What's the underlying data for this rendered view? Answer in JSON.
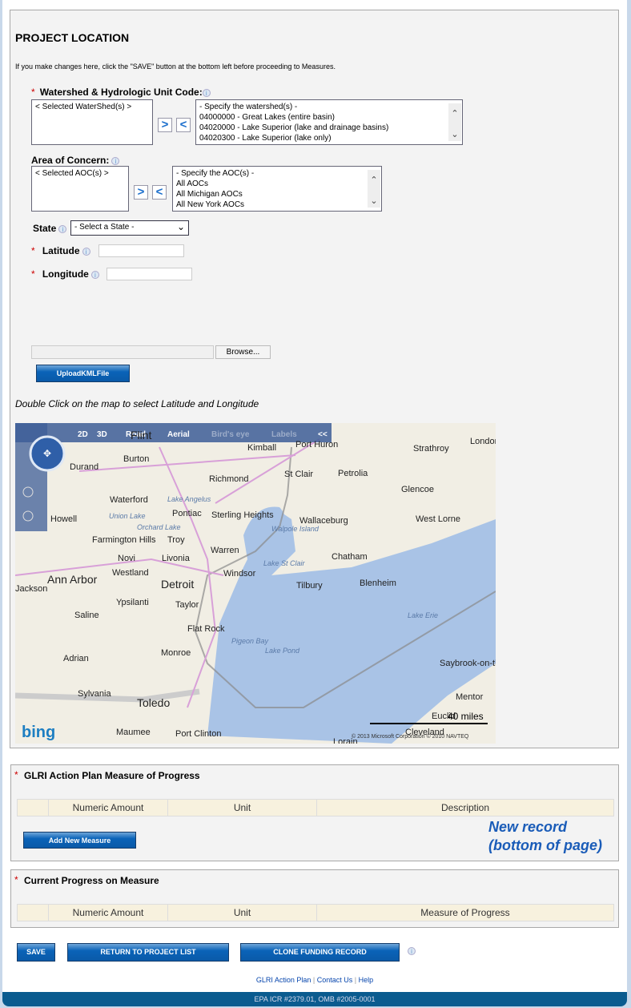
{
  "title": "PROJECT LOCATION",
  "note": "If you make changes here, click the \"SAVE\" button at the bottom left before proceeding to Measures.",
  "watershed": {
    "label": "Watershed & Hydrologic Unit Code:",
    "selected_placeholder": "< Selected WaterShed(s) >",
    "options": [
      "- Specify the watershed(s) -",
      "04000000 - Great Lakes (entire basin)",
      "04020000 - Lake Superior (lake and drainage basins)",
      "04020300 - Lake Superior (lake only)"
    ]
  },
  "aoc": {
    "label": "Area of Concern:",
    "selected_placeholder": "< Selected AOC(s) >",
    "options": [
      "- Specify the AOC(s) -",
      "All AOCs",
      "All Michigan AOCs",
      "All New York AOCs"
    ]
  },
  "move_right": ">",
  "move_left": "<",
  "state": {
    "label": "State",
    "value": "- Select a State -"
  },
  "latitude": {
    "label": "Latitude",
    "value": ""
  },
  "longitude": {
    "label": "Longitude",
    "value": ""
  },
  "browse_label": "Browse...",
  "upload_label": "UploadKMLFile",
  "map_hint": "Double Click on the map to select Latitude and Longitude",
  "map": {
    "modes": [
      "2D",
      "3D",
      "Road",
      "Aerial",
      "Bird's eye",
      "Labels",
      "<<"
    ],
    "places": [
      "Port Huron",
      "Kimball",
      "Burton",
      "Durand",
      "Richmond",
      "St Clair",
      "Petrolia",
      "Strathroy",
      "London",
      "Glencoe",
      "Waterford",
      "Lake Angelus",
      "Pontiac",
      "Sterling Heights",
      "Howell",
      "Union Lake",
      "Orchard Lake",
      "Wallaceburg",
      "West Lorne",
      "Farmington Hills",
      "Troy",
      "Walpole Island",
      "Novi",
      "Livonia",
      "Warren",
      "Chatham",
      "Ann Arbor",
      "Westland",
      "Windsor",
      "Lake St Clair",
      "Blenheim",
      "Detroit",
      "Tilbury",
      "Ypsilanti",
      "Taylor",
      "Saline",
      "Flat Rock",
      "Lake Erie",
      "Pigeon Bay",
      "Lake Pond",
      "Adrian",
      "Monroe",
      "Saybrook-on-the",
      "Sylvania",
      "Toledo",
      "Mentor",
      "Euclid",
      "Cleveland",
      "Maumee",
      "Port Clinton",
      "Lorain",
      "Flint",
      "Jackson"
    ],
    "scale": "40 miles",
    "copyright": "© 2013 Microsoft Corporation  © 2010 NAVTEQ",
    "logo": "bing"
  },
  "measure": {
    "title": "GLRI Action Plan Measure of Progress",
    "columns": [
      "",
      "Numeric Amount",
      "Unit",
      "Description"
    ],
    "add_label": "Add New Measure"
  },
  "annotation": "New record (bottom of page)",
  "progress": {
    "title": "Current Progress on Measure",
    "columns": [
      "",
      "Numeric Amount",
      "Unit",
      "Measure of Progress"
    ]
  },
  "buttons": {
    "save": "SAVE",
    "return": "RETURN TO PROJECT LIST",
    "clone": "CLONE FUNDING RECORD"
  },
  "footer": {
    "links": [
      "GLRI Action Plan",
      "Contact Us",
      "Help"
    ],
    "text": "EPA ICR #2379.01, OMB #2005-0001"
  }
}
